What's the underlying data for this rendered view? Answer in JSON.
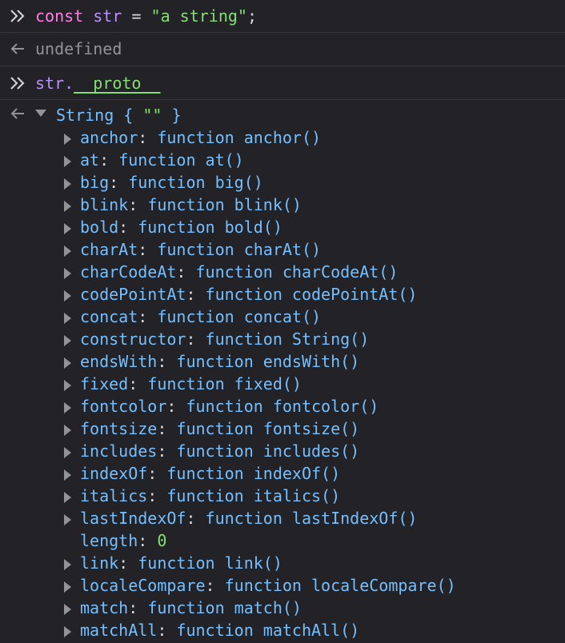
{
  "console": {
    "input1": {
      "keyword": "const",
      "varname": "str",
      "operator": "=",
      "string_value": "\"a string\"",
      "terminator": ";"
    },
    "output1": {
      "value": "undefined"
    },
    "input2": {
      "object": "str.",
      "property": "__proto__"
    },
    "output2": {
      "type_name": "String",
      "open_brace": "{",
      "preview": "\"\"",
      "close_brace": "}"
    }
  },
  "properties": [
    {
      "name": "anchor",
      "value": "function anchor()",
      "expandable": true
    },
    {
      "name": "at",
      "value": "function at()",
      "expandable": true
    },
    {
      "name": "big",
      "value": "function big()",
      "expandable": true
    },
    {
      "name": "blink",
      "value": "function blink()",
      "expandable": true
    },
    {
      "name": "bold",
      "value": "function bold()",
      "expandable": true
    },
    {
      "name": "charAt",
      "value": "function charAt()",
      "expandable": true
    },
    {
      "name": "charCodeAt",
      "value": "function charCodeAt()",
      "expandable": true
    },
    {
      "name": "codePointAt",
      "value": "function codePointAt()",
      "expandable": true
    },
    {
      "name": "concat",
      "value": "function concat()",
      "expandable": true
    },
    {
      "name": "constructor",
      "value": "function String()",
      "expandable": true
    },
    {
      "name": "endsWith",
      "value": "function endsWith()",
      "expandable": true
    },
    {
      "name": "fixed",
      "value": "function fixed()",
      "expandable": true
    },
    {
      "name": "fontcolor",
      "value": "function fontcolor()",
      "expandable": true
    },
    {
      "name": "fontsize",
      "value": "function fontsize()",
      "expandable": true
    },
    {
      "name": "includes",
      "value": "function includes()",
      "expandable": true
    },
    {
      "name": "indexOf",
      "value": "function indexOf()",
      "expandable": true
    },
    {
      "name": "italics",
      "value": "function italics()",
      "expandable": true
    },
    {
      "name": "lastIndexOf",
      "value": "function lastIndexOf()",
      "expandable": true
    },
    {
      "name": "length",
      "value": "0",
      "expandable": false,
      "numeric": true
    },
    {
      "name": "link",
      "value": "function link()",
      "expandable": true
    },
    {
      "name": "localeCompare",
      "value": "function localeCompare()",
      "expandable": true
    },
    {
      "name": "match",
      "value": "function match()",
      "expandable": true
    },
    {
      "name": "matchAll",
      "value": "function matchAll()",
      "expandable": true
    }
  ],
  "colors": {
    "background": "#232327",
    "keyword": "#ff7de9",
    "variable": "#b98eff",
    "string": "#86de74",
    "property": "#75bfff",
    "muted": "#939395"
  },
  "icons": {
    "input_prompt": "double-chevron-right-icon",
    "output_marker": "arrow-left-icon",
    "expand_open": "triangle-down-icon",
    "expand_closed": "triangle-right-icon"
  }
}
